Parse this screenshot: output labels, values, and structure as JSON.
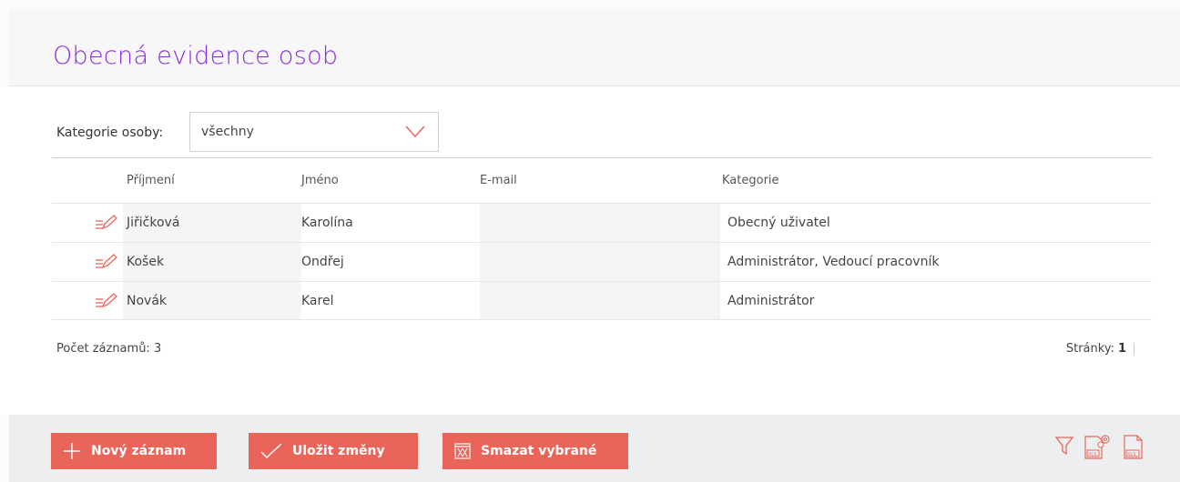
{
  "header": {
    "title": "Obecná evidence osob"
  },
  "filter": {
    "label": "Kategorie osoby:",
    "selected": "všechny"
  },
  "table": {
    "columns": [
      "Příjmení",
      "Jméno",
      "E-mail",
      "Kategorie"
    ],
    "rows": [
      {
        "prijmeni": "Jiřičková",
        "jmeno": "Karolína",
        "email": "",
        "kategorie": "Obecný uživatel"
      },
      {
        "prijmeni": "Košek",
        "jmeno": "Ondřej",
        "email": "",
        "kategorie": "Administrátor, Vedoucí pracovník"
      },
      {
        "prijmeni": "Novák",
        "jmeno": "Karel",
        "email": "",
        "kategorie": "Administrátor"
      }
    ]
  },
  "summary": {
    "count_label": "Počet záznamů: 3",
    "pages_label": "Stránky:",
    "current_page": "1"
  },
  "toolbar": {
    "new_label": "Nový záznam",
    "save_label": "Uložit změny",
    "delete_label": "Smazat vybrané"
  },
  "colors": {
    "accent": "#e9655a",
    "title": "#8a2be2"
  },
  "icons": [
    "edit-icon",
    "plus-icon",
    "check-icon",
    "delete-icon",
    "filter-icon",
    "export-settings-icon",
    "export-xls-icon"
  ]
}
